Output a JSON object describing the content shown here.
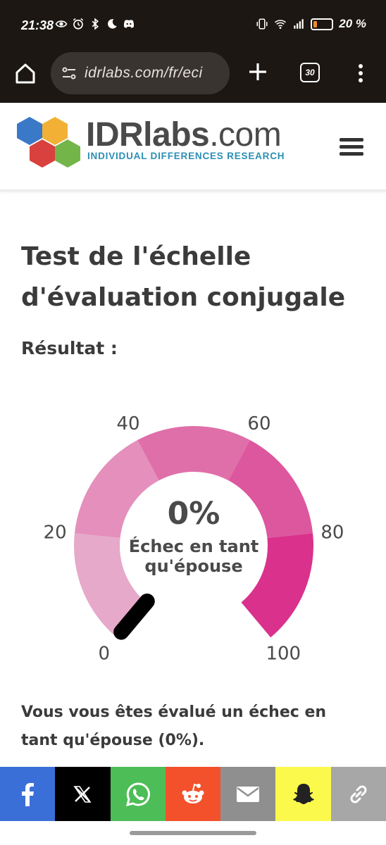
{
  "status_bar": {
    "time": "21:38",
    "battery_percent": "20 %",
    "battery_level": 0.2,
    "icons": [
      "eye-icon",
      "alarm-icon",
      "bluetooth-icon",
      "moon-icon",
      "discord-icon",
      "vibrate-icon",
      "wifi-icon",
      "signal-icon",
      "battery-icon"
    ]
  },
  "browser": {
    "url": "idrlabs.com/fr/eci",
    "tab_count": "30",
    "icons": [
      "home-icon",
      "site-settings-icon",
      "plus-icon",
      "tabs-icon",
      "more-vertical-icon"
    ]
  },
  "site": {
    "brand_bold": "IDRlabs",
    "brand_light": ".com",
    "tagline": "INDIVIDUAL DIFFERENCES RESEARCH",
    "hex_colors": [
      "#3a78c8",
      "#f2b134",
      "#d9413e",
      "#74b54a"
    ]
  },
  "page": {
    "title": "Test de l'échelle d'évaluation conjugale",
    "result_label": "Résultat :",
    "summary": "Vous vous êtes évalué un échec en tant qu'épouse (0%)."
  },
  "gauge": {
    "value": 0,
    "value_label": "0%",
    "caption_line1": "Échec en tant",
    "caption_line2": "qu'épouse",
    "ticks": [
      "0",
      "20",
      "40",
      "60",
      "80",
      "100"
    ],
    "segment_colors": [
      "#e6a9c9",
      "#e48fbc",
      "#df6fa8",
      "#dc579e",
      "#d9318c"
    ]
  },
  "share_bar": [
    {
      "name": "facebook",
      "color": "#3b6fd8",
      "icon": "facebook-icon"
    },
    {
      "name": "x",
      "color": "#000000",
      "icon": "x-icon"
    },
    {
      "name": "whatsapp",
      "color": "#4dbd57",
      "icon": "whatsapp-icon"
    },
    {
      "name": "reddit",
      "color": "#f2512b",
      "icon": "reddit-icon"
    },
    {
      "name": "email",
      "color": "#8f8f8f",
      "icon": "email-icon"
    },
    {
      "name": "snapchat",
      "color": "#fbfa4c",
      "icon": "snapchat-icon"
    },
    {
      "name": "copy-link",
      "color": "#a7a7a7",
      "icon": "link-icon"
    }
  ]
}
